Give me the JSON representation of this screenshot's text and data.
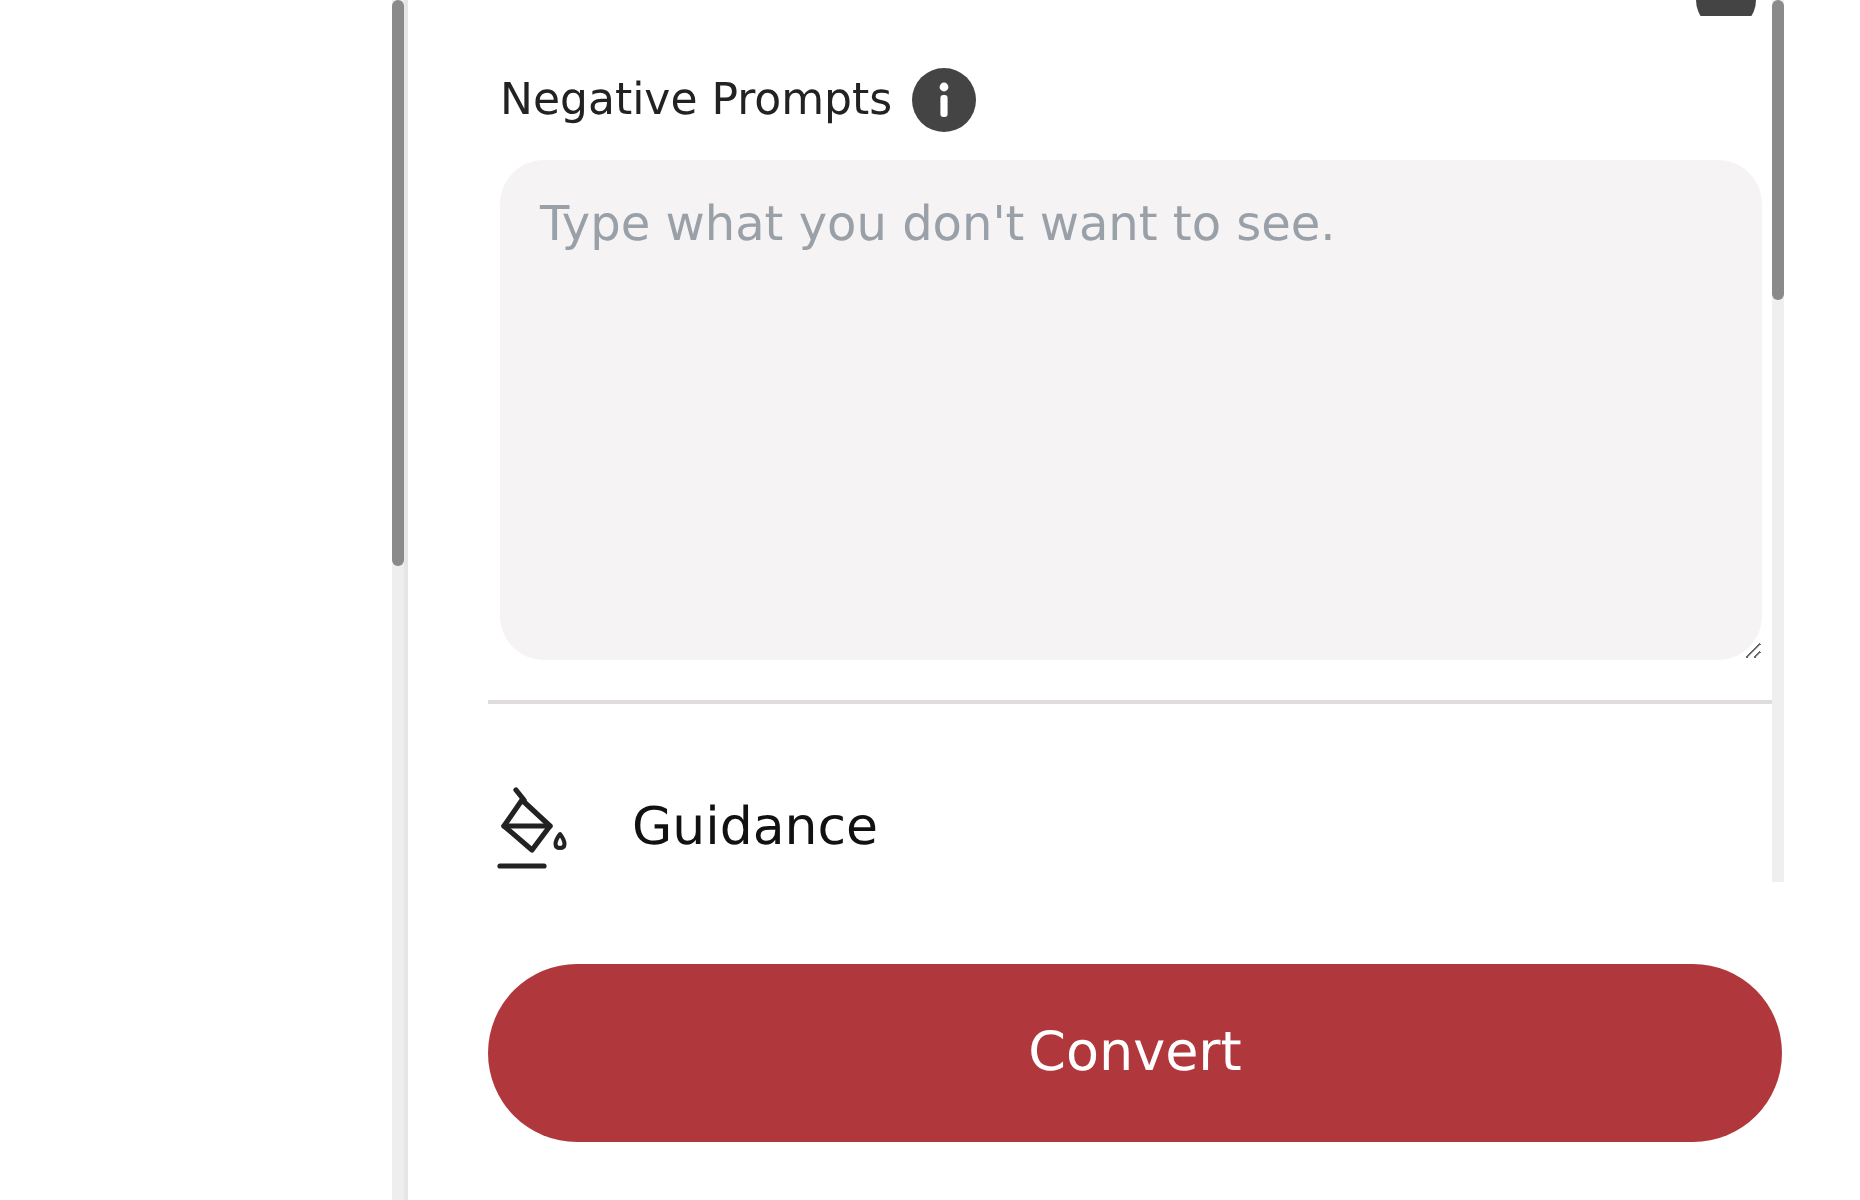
{
  "negative_prompts": {
    "label": "Negative Prompts",
    "placeholder": "Type what you don't want to see."
  },
  "guidance": {
    "label": "Guidance"
  },
  "convert_button": {
    "label": "Convert"
  }
}
